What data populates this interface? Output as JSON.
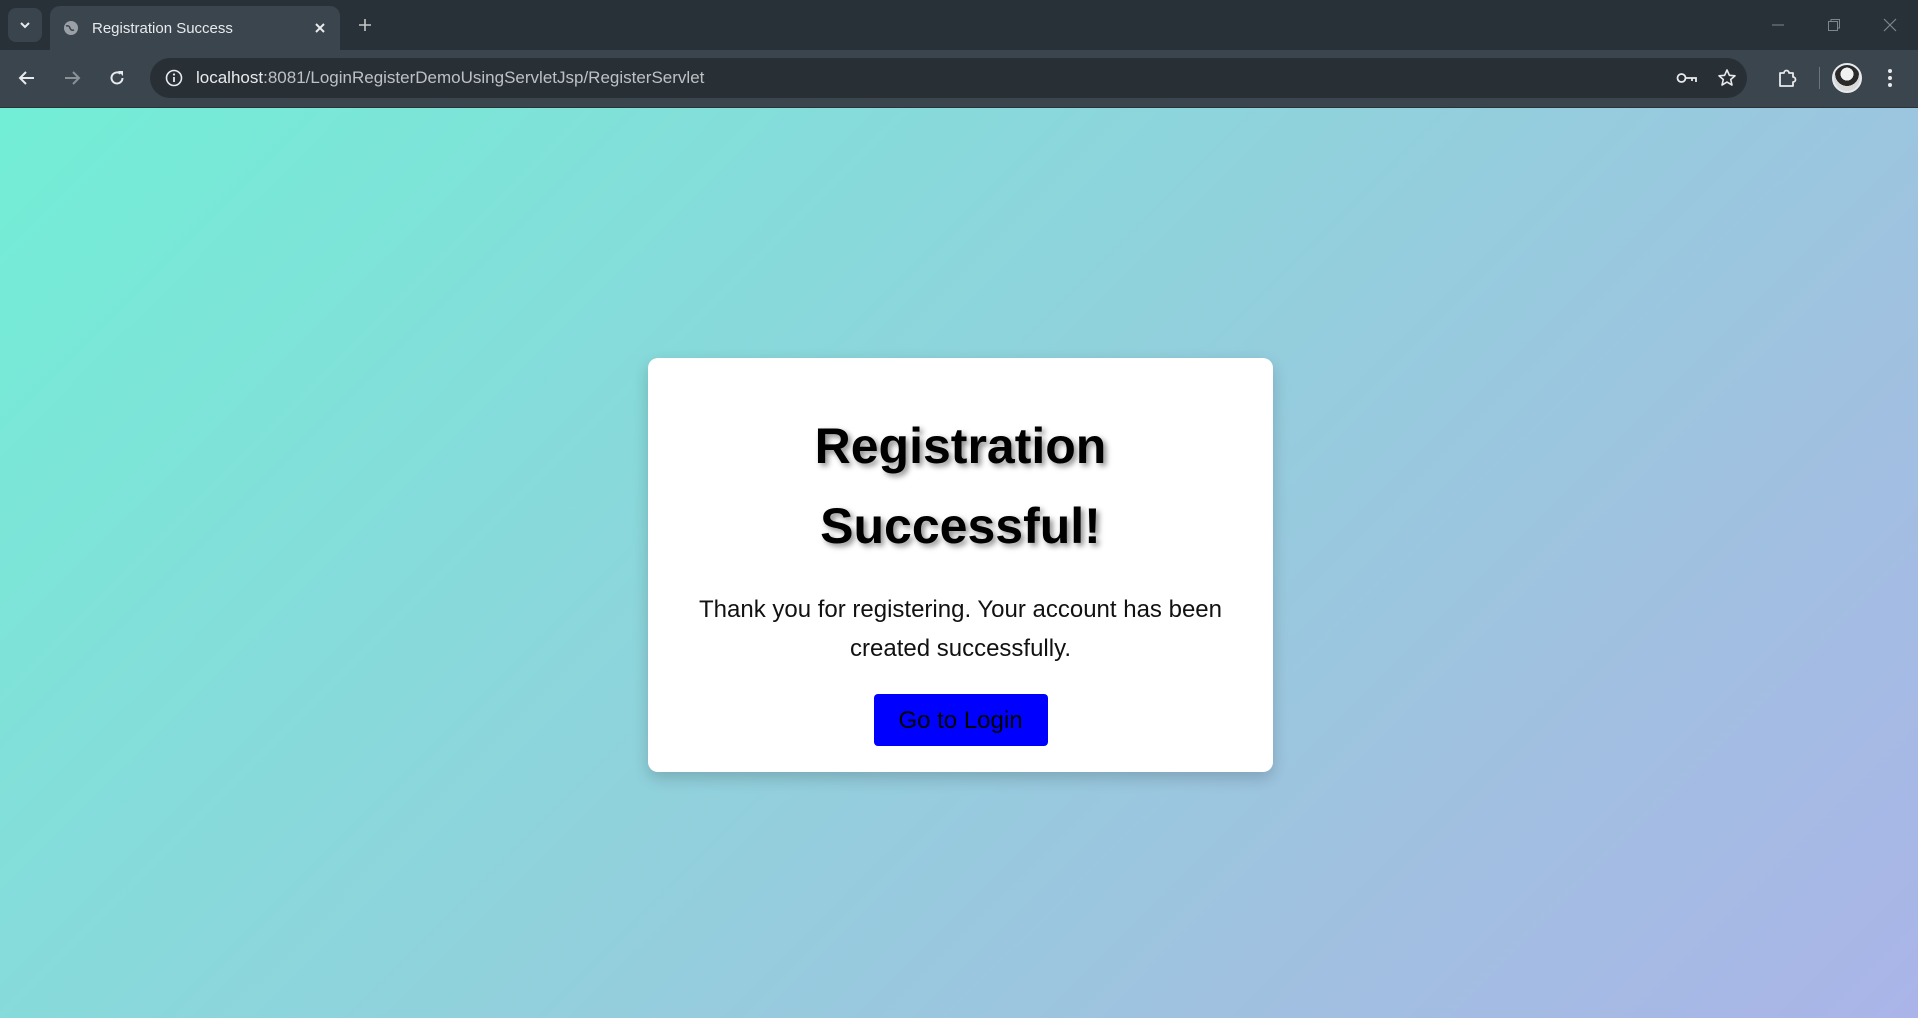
{
  "browser": {
    "tab_title": "Registration Success",
    "url_host": "localhost",
    "url_rest": ":8081/LoginRegisterDemoUsingServletJsp/RegisterServlet"
  },
  "page": {
    "heading": "Registration Successful!",
    "message": "Thank you for registering. Your account has been created successfully.",
    "button_label": "Go to Login"
  },
  "colors": {
    "button": "#0000ff",
    "gradient_start": "#72eed6",
    "gradient_end": "#aab4e8"
  }
}
